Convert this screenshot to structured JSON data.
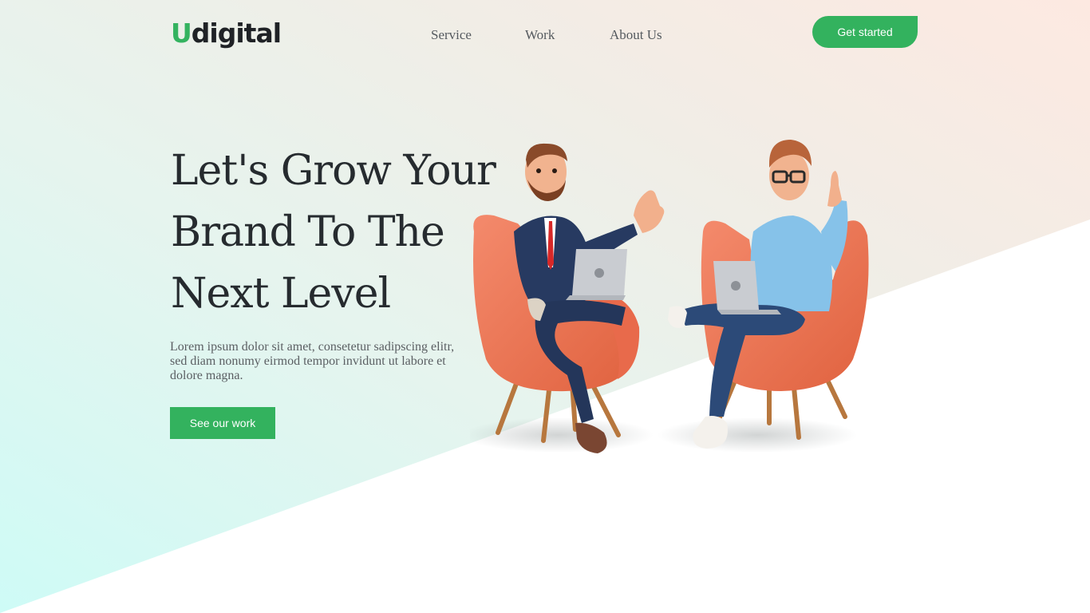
{
  "brand": {
    "logo_letter": "U",
    "logo_rest": "digital",
    "accent": "#34b360"
  },
  "nav": {
    "items": [
      "Service",
      "Work",
      "About Us"
    ],
    "cta": "Get started"
  },
  "hero": {
    "title_lines": [
      "Let's Grow Your",
      "Brand To The",
      "Next Level"
    ],
    "description": "Lorem ipsum dolor sit amet, consetetur sadipscing elitr, sed diam nonumy eirmod tempor invidunt ut labore et dolore magna.",
    "button": "See our work"
  },
  "illustration": {
    "icon": "two-people-in-armchairs-with-laptops",
    "chair_color": "#f07a5c"
  }
}
